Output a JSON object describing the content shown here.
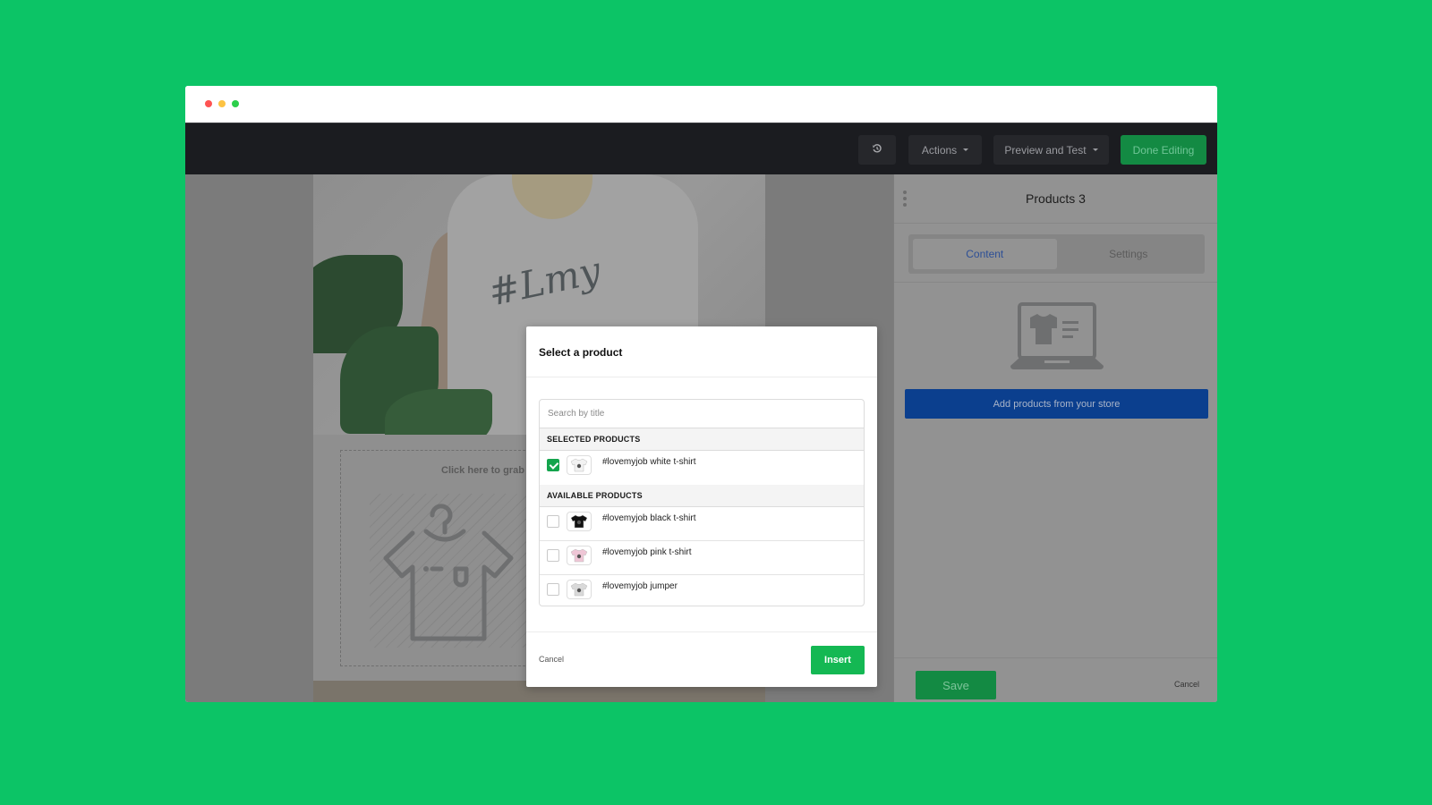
{
  "window": {
    "controls": [
      "close",
      "minimize",
      "maximize"
    ]
  },
  "toolbar": {
    "history_icon": "history-icon",
    "actions_label": "Actions",
    "preview_label": "Preview and Test",
    "done_label": "Done Editing"
  },
  "canvas": {
    "hero_print": "#Lmy",
    "dropzone_text": "Click here to grab a"
  },
  "sidepanel": {
    "title": "Products 3",
    "tabs": [
      {
        "label": "Content",
        "active": true
      },
      {
        "label": "Settings",
        "active": false
      }
    ],
    "add_button": "Add products from your store",
    "save_label": "Save",
    "cancel_label": "Cancel"
  },
  "modal": {
    "title": "Select a product",
    "search_placeholder": "Search by title",
    "selected_header": "SELECTED PRODUCTS",
    "available_header": "AVAILABLE PRODUCTS",
    "selected": [
      {
        "name": "#lovemyjob white t-shirt",
        "checked": true,
        "thumb_color": "#f2f2f2"
      }
    ],
    "available": [
      {
        "name": "#lovemyjob black t-shirt",
        "checked": false,
        "thumb_color": "#111111"
      },
      {
        "name": "#lovemyjob pink t-shirt",
        "checked": false,
        "thumb_color": "#efc6d6"
      },
      {
        "name": "#lovemyjob jumper",
        "checked": false,
        "thumb_color": "#d9d9d9"
      }
    ],
    "cancel_label": "Cancel",
    "insert_label": "Insert"
  },
  "colors": {
    "background": "#0cc466",
    "accent_green": "#14b853",
    "blue_button": "#0b3f8e",
    "topbar": "#1b1c20"
  }
}
